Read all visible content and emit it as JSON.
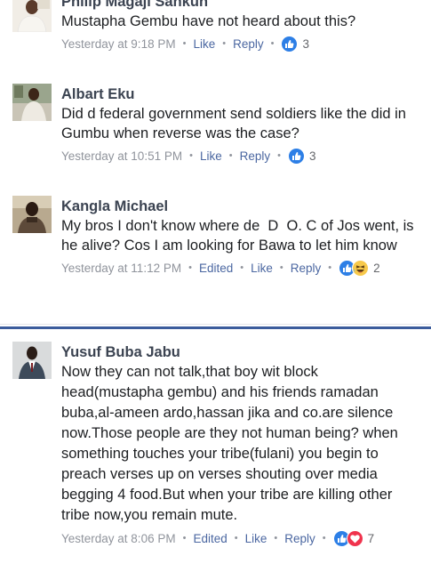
{
  "comments": [
    {
      "name": "Philip Magaji Sankun",
      "text": "Mustapha Gembu have not heard about this?",
      "time": "Yesterday at 9:18 PM",
      "edited": "",
      "like": "Like",
      "reply": "Reply",
      "reactions": [
        "like"
      ],
      "count": "3"
    },
    {
      "name": "Albart Eku",
      "text": "Did d federal government send soldiers like the did in Gumbu when reverse was the case?",
      "time": "Yesterday at 10:51 PM",
      "edited": "",
      "like": "Like",
      "reply": "Reply",
      "reactions": [
        "like"
      ],
      "count": "3"
    },
    {
      "name": "Kangla Michael",
      "text": "My bros I don't know where de  D  O. C of Jos went, is he alive? Cos I am looking for Bawa to let him know",
      "time": "Yesterday at 11:12 PM",
      "edited": "Edited",
      "like": "Like",
      "reply": "Reply",
      "reactions": [
        "like",
        "haha"
      ],
      "count": "2"
    },
    {
      "name": "Yusuf Buba Jabu",
      "text": "Now they can not talk,that boy wit block head(mustapha gembu) and his friends ramadan buba,al-ameen ardo,hassan jika and co.are silence now.Those people are they not human being? when something touches your tribe(fulani) you begin to preach verses up on verses shouting over media begging 4 food.But when your tribe are killing other tribe now,you remain mute.",
      "time": "Yesterday at 8:06 PM",
      "edited": "Edited",
      "like": "Like",
      "reply": "Reply",
      "reactions": [
        "like",
        "love"
      ],
      "count": "7"
    }
  ],
  "colors": {
    "name": "#3b4351",
    "meta": "#90949c",
    "link": "#4b67a1",
    "like": "#2d7fe6",
    "love": "#f0334d",
    "haha": "#f7c94b",
    "divider": "#3b5c9c"
  }
}
